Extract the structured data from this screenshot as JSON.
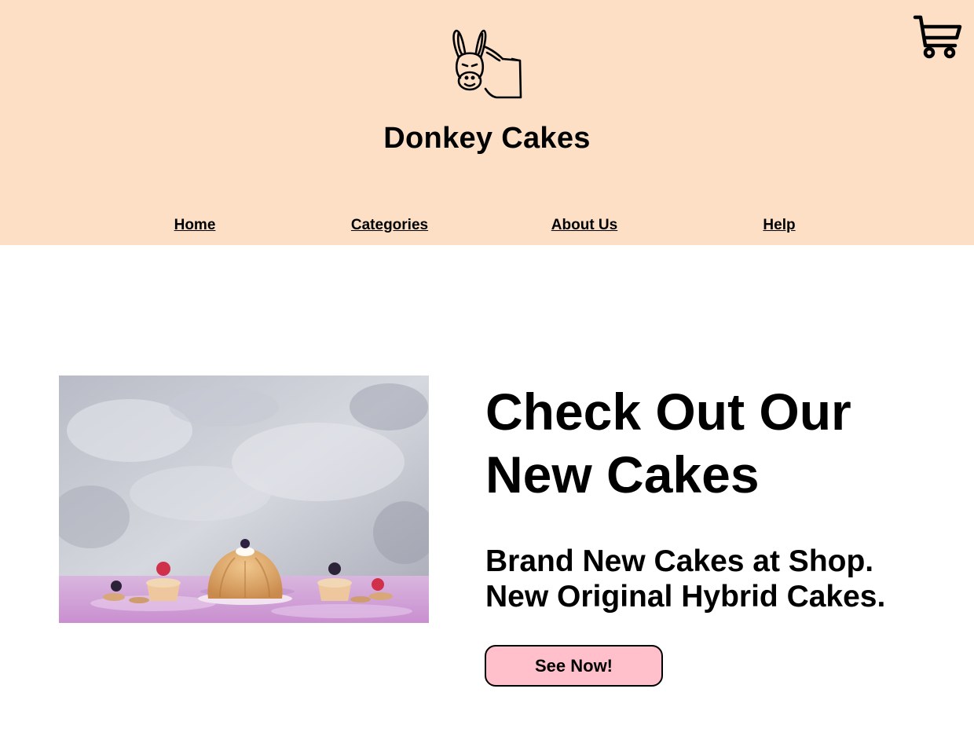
{
  "header": {
    "title": "Donkey Cakes",
    "logo_icon": "donkey-logo-icon",
    "cart_icon": "shopping-cart-icon",
    "background_color": "#fcdfc5"
  },
  "nav": {
    "items": [
      {
        "label": "Home"
      },
      {
        "label": "Categories"
      },
      {
        "label": "About Us"
      },
      {
        "label": "Help"
      }
    ]
  },
  "hero": {
    "title_line1": "Check Out Our",
    "title_line2": "New Cakes",
    "subtitle_line1": "Brand New Cakes at Shop.",
    "subtitle_line2": "New Original Hybrid Cakes.",
    "button_label": "See Now!",
    "button_color": "#ffc0cb"
  }
}
